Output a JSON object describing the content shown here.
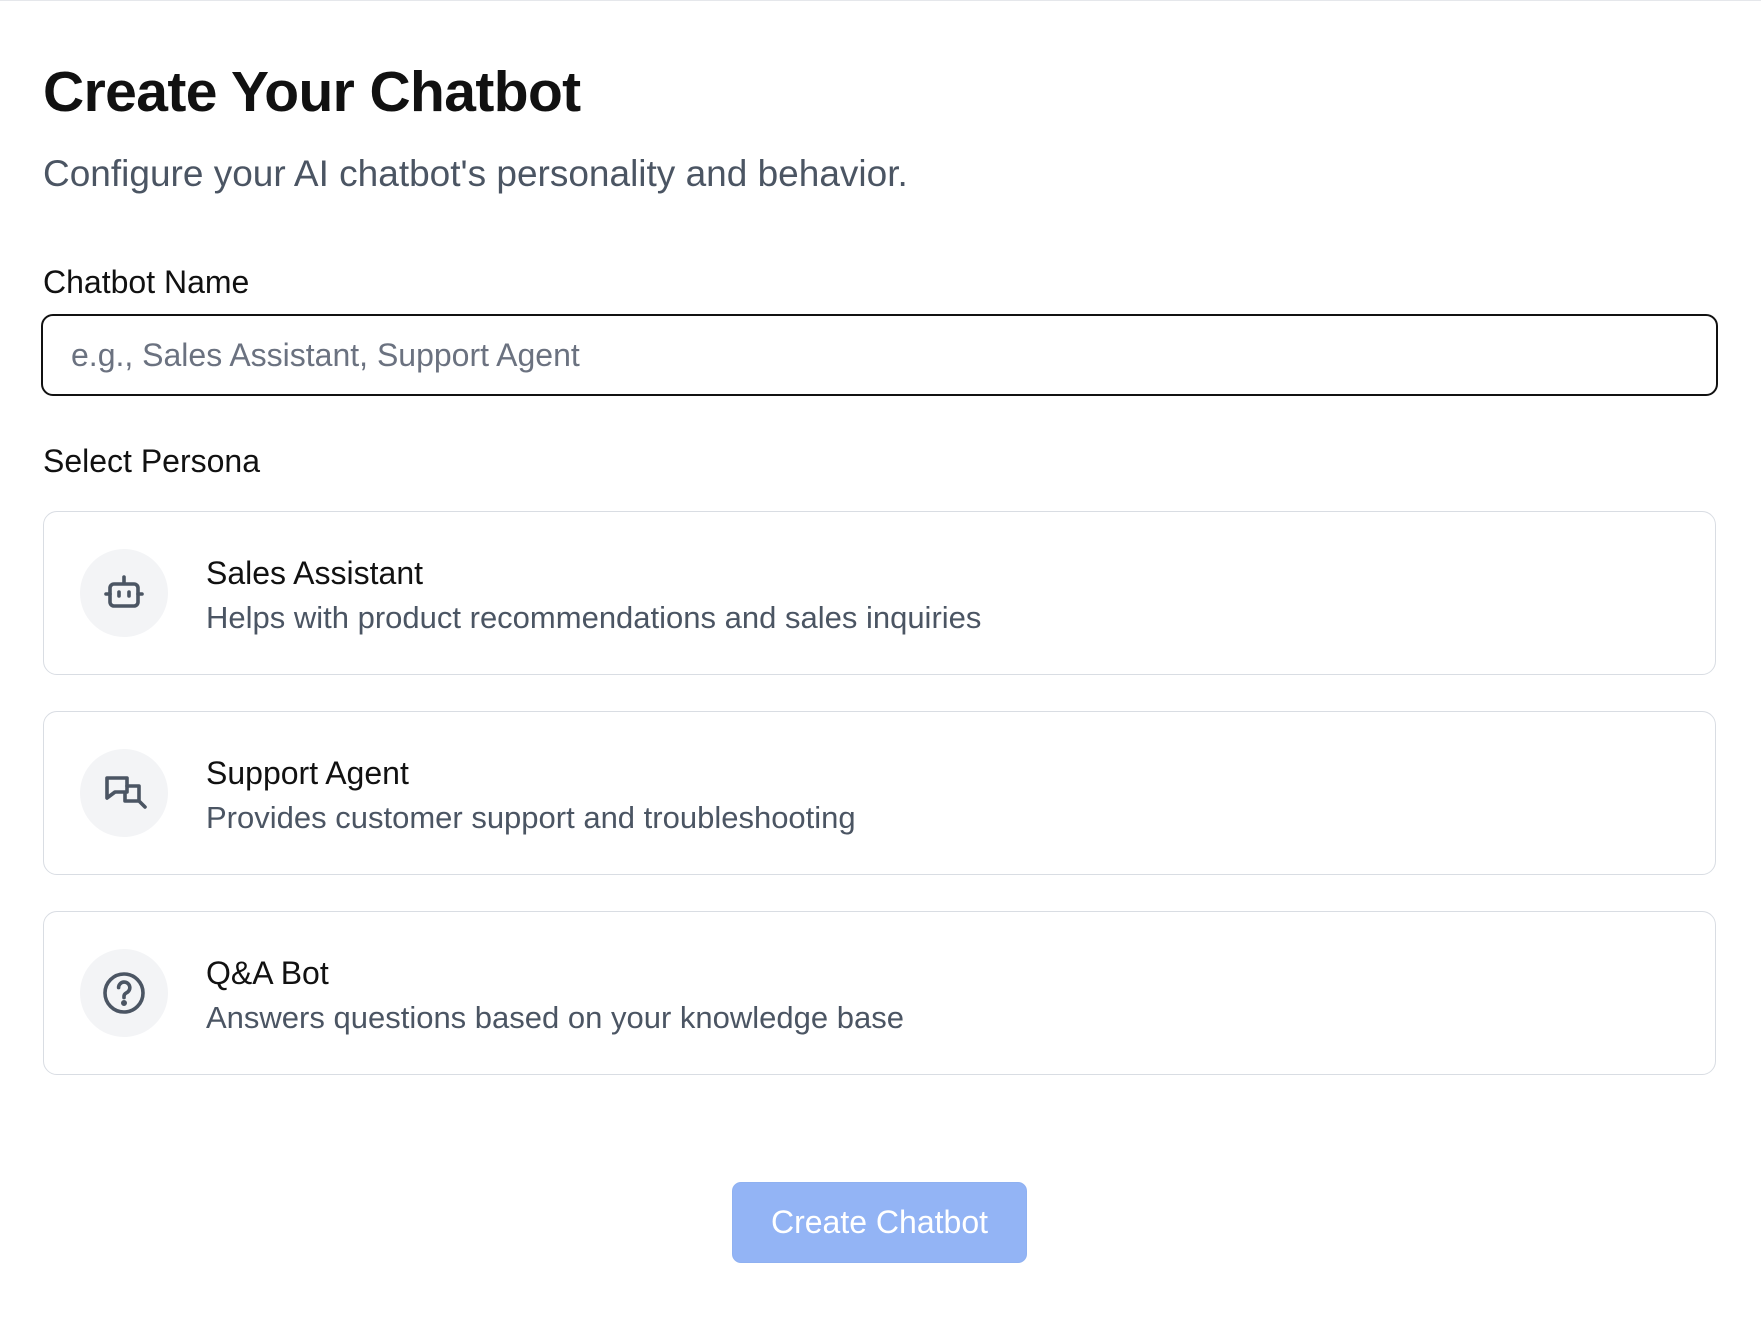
{
  "header": {
    "title": "Create Your Chatbot",
    "subtitle": "Configure your AI chatbot's personality and behavior."
  },
  "form": {
    "name_label": "Chatbot Name",
    "name_value": "",
    "name_placeholder": "e.g., Sales Assistant, Support Agent",
    "persona_label": "Select Persona",
    "personas": [
      {
        "icon": "robot-icon",
        "title": "Sales Assistant",
        "description": "Helps with product recommendations and sales inquiries"
      },
      {
        "icon": "chat-bubbles-icon",
        "title": "Support Agent",
        "description": "Provides customer support and troubleshooting"
      },
      {
        "icon": "question-circle-icon",
        "title": "Q&A Bot",
        "description": "Answers questions based on your knowledge base"
      }
    ],
    "submit_label": "Create Chatbot"
  },
  "colors": {
    "primary_disabled": "#93b4f5",
    "text_primary": "#111111",
    "text_secondary": "#4b5563",
    "card_border": "#d9dde3",
    "icon_bg": "#f3f4f6"
  }
}
